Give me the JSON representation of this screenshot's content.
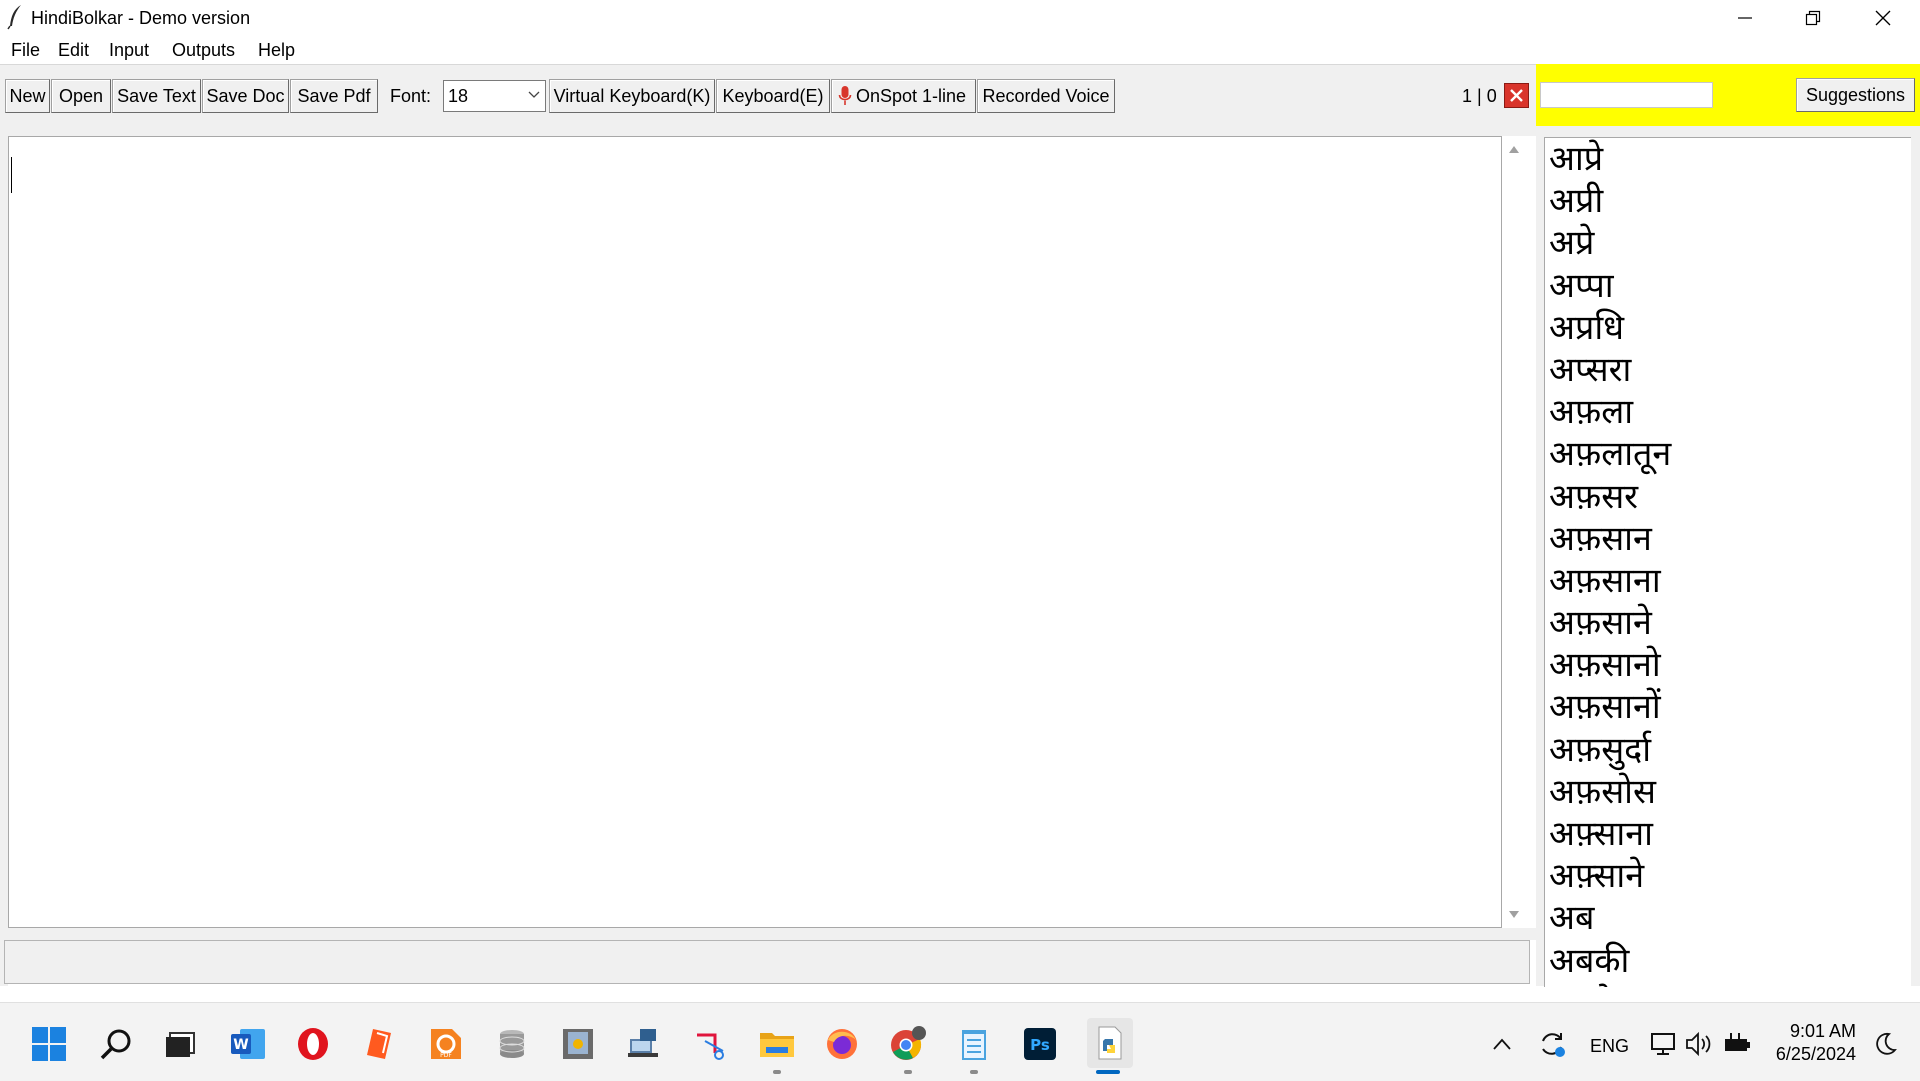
{
  "window": {
    "title": "HindiBolkar - Demo version"
  },
  "menu": [
    "File",
    "Edit",
    "Input",
    "Outputs",
    "Help"
  ],
  "toolbar": {
    "new_label": "New",
    "open_label": "Open",
    "save_text_label": "Save Text",
    "save_doc_label": "Save Doc",
    "save_pdf_label": "Save Pdf",
    "font_label": "Font:",
    "font_size_value": "18",
    "virtual_keyboard_label": "Virtual Keyboard(K)",
    "keyboard_label": "Keyboard(E)",
    "onspot_label": "OnSpot 1-line",
    "recorded_voice_label": "Recorded Voice",
    "counter": "1 | 0"
  },
  "suggestions": {
    "input_value": "",
    "button_label": "Suggestions",
    "header_color": "#ffff00",
    "items": [
      "आप्रे",
      "अप्री",
      "अप्रे",
      "अप्पा",
      "अप्रधि",
      "अप्सरा",
      "अफ़ला",
      "अफ़लातून",
      "अफ़सर",
      "अफ़सान",
      "अफ़साना",
      "अफ़साने",
      "अफ़सानो",
      "अफ़सानों",
      "अफ़सुर्दा",
      "अफ़सोस",
      "अफ़्साना",
      "अफ़्साने",
      "अब",
      "अबकी",
      "अबके"
    ]
  },
  "editor": {
    "content": ""
  },
  "statusbar": {
    "text": ""
  },
  "taskbar": {
    "language": "ENG",
    "time": "9:01 AM",
    "date": "6/25/2024"
  }
}
